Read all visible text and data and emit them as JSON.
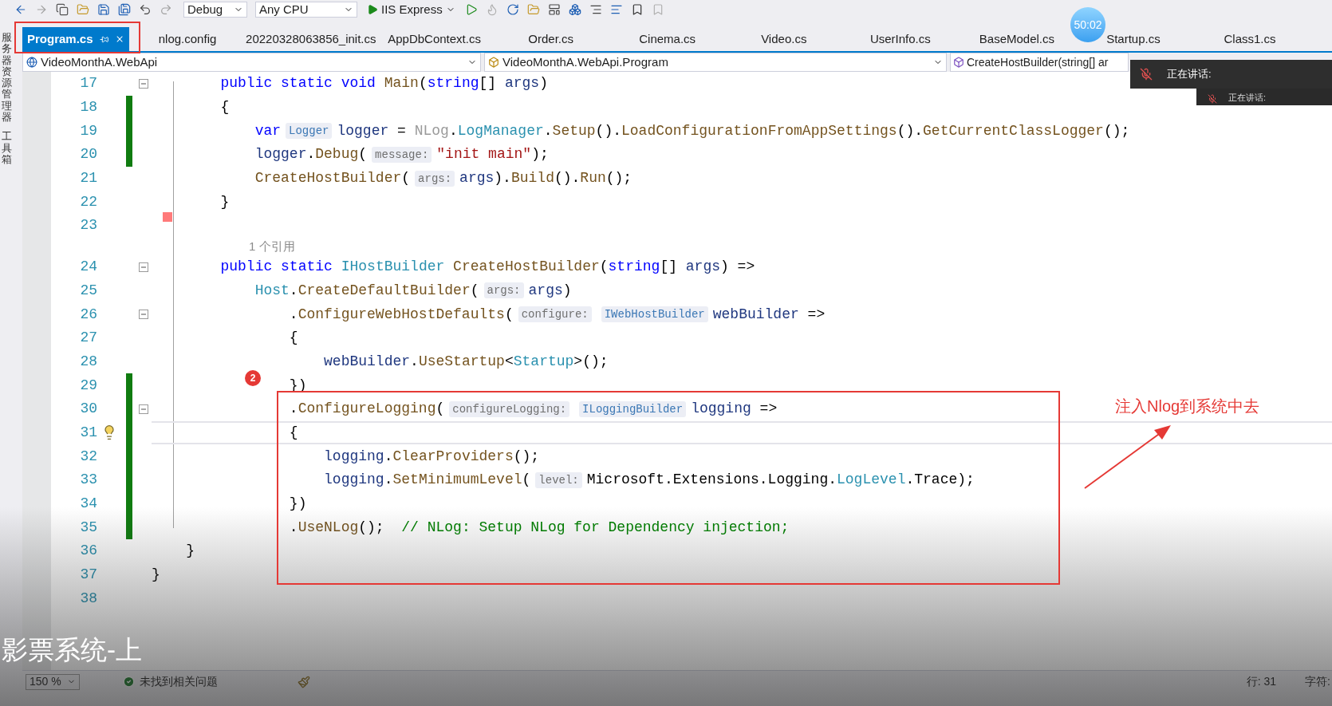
{
  "toolbar": {
    "configuration": "Debug",
    "platform": "Any CPU",
    "run_target": "IIS Express"
  },
  "timer": "50:02",
  "side_panels": [
    "服务器资源管理器",
    "工具箱"
  ],
  "tabs": [
    {
      "label": "Program.cs",
      "selected": true
    },
    {
      "label": "nlog.config",
      "selected": false
    },
    {
      "label": "20220328063856_init.cs",
      "selected": false
    },
    {
      "label": "AppDbContext.cs",
      "selected": false
    },
    {
      "label": "Order.cs",
      "selected": false
    },
    {
      "label": "Cinema.cs",
      "selected": false
    },
    {
      "label": "Video.cs",
      "selected": false
    },
    {
      "label": "UserInfo.cs",
      "selected": false
    },
    {
      "label": "BaseModel.cs",
      "selected": false
    },
    {
      "label": "Startup.cs",
      "selected": false
    },
    {
      "label": "Class1.cs",
      "selected": false
    }
  ],
  "nav": {
    "project": "VideoMonthA.WebApi",
    "type": "VideoMonthA.WebApi.Program",
    "member": "CreateHostBuilder(string[] ar"
  },
  "speaker_panels": [
    {
      "label": "正在讲话:"
    },
    {
      "label": "正在讲话:"
    }
  ],
  "code_lines": [
    {
      "kind": "code",
      "number": "17",
      "changed": false,
      "foldable": true,
      "current": false,
      "lightbulb": false,
      "tokens": [
        {
          "kind": "kw",
          "text": "        public static void"
        },
        {
          "kind": "fn",
          "text": " Main"
        },
        {
          "kind": "p",
          "text": "("
        },
        {
          "kind": "kw",
          "text": "string"
        },
        {
          "kind": "p",
          "text": "[] "
        },
        {
          "kind": "var",
          "text": "args"
        },
        {
          "kind": "p",
          "text": ")"
        }
      ]
    },
    {
      "kind": "code",
      "number": "18",
      "changed": true,
      "foldable": false,
      "current": false,
      "lightbulb": false,
      "tokens": [
        {
          "kind": "p",
          "text": "        {"
        }
      ]
    },
    {
      "kind": "code",
      "number": "19",
      "changed": true,
      "foldable": false,
      "current": false,
      "lightbulb": false,
      "tokens": [
        {
          "kind": "kw",
          "text": "            var"
        },
        {
          "kind": "typehint",
          "text": "Logger"
        },
        {
          "kind": "var",
          "text": "logger"
        },
        {
          "kind": "p",
          "text": " = "
        },
        {
          "kind": "dim",
          "text": "NLog"
        },
        {
          "kind": "p",
          "text": "."
        },
        {
          "kind": "type",
          "text": "LogManager"
        },
        {
          "kind": "p",
          "text": "."
        },
        {
          "kind": "fn",
          "text": "Setup"
        },
        {
          "kind": "p",
          "text": "()."
        },
        {
          "kind": "fn",
          "text": "LoadConfigurationFromAppSettings"
        },
        {
          "kind": "p",
          "text": "()."
        },
        {
          "kind": "fn",
          "text": "GetCurrentClassLogger"
        },
        {
          "kind": "p",
          "text": "();"
        }
      ]
    },
    {
      "kind": "code",
      "number": "20",
      "changed": true,
      "foldable": false,
      "current": false,
      "lightbulb": false,
      "tokens": [
        {
          "kind": "var",
          "text": "            logger"
        },
        {
          "kind": "p",
          "text": "."
        },
        {
          "kind": "fn",
          "text": "Debug"
        },
        {
          "kind": "p",
          "text": "("
        },
        {
          "kind": "hint",
          "text": "message:"
        },
        {
          "kind": "str",
          "text": "\"init main\""
        },
        {
          "kind": "p",
          "text": ");"
        }
      ]
    },
    {
      "kind": "code",
      "number": "21",
      "changed": false,
      "foldable": false,
      "current": false,
      "lightbulb": false,
      "tokens": [
        {
          "kind": "fn",
          "text": "            CreateHostBuilder"
        },
        {
          "kind": "p",
          "text": "("
        },
        {
          "kind": "hint",
          "text": "args:"
        },
        {
          "kind": "var",
          "text": "args"
        },
        {
          "kind": "p",
          "text": ")."
        },
        {
          "kind": "fn",
          "text": "Build"
        },
        {
          "kind": "p",
          "text": "()."
        },
        {
          "kind": "fn",
          "text": "Run"
        },
        {
          "kind": "p",
          "text": "();"
        }
      ]
    },
    {
      "kind": "code",
      "number": "22",
      "changed": false,
      "foldable": false,
      "current": false,
      "lightbulb": false,
      "tokens": [
        {
          "kind": "p",
          "text": "        }"
        }
      ]
    },
    {
      "kind": "code",
      "number": "23",
      "changed": false,
      "foldable": false,
      "current": false,
      "lightbulb": false
    },
    {
      "kind": "lens",
      "text": "1 个引用"
    },
    {
      "kind": "code",
      "number": "24",
      "changed": false,
      "foldable": true,
      "current": false,
      "lightbulb": false,
      "tokens": [
        {
          "kind": "kw",
          "text": "        public static"
        },
        {
          "kind": "type",
          "text": " IHostBuilder"
        },
        {
          "kind": "fn",
          "text": " CreateHostBuilder"
        },
        {
          "kind": "p",
          "text": "("
        },
        {
          "kind": "kw",
          "text": "string"
        },
        {
          "kind": "p",
          "text": "[] "
        },
        {
          "kind": "var",
          "text": "args"
        },
        {
          "kind": "p",
          "text": ") =>"
        }
      ]
    },
    {
      "kind": "code",
      "number": "25",
      "changed": false,
      "foldable": false,
      "current": false,
      "lightbulb": false,
      "tokens": [
        {
          "kind": "type",
          "text": "            Host"
        },
        {
          "kind": "p",
          "text": "."
        },
        {
          "kind": "fn",
          "text": "CreateDefaultBuilder"
        },
        {
          "kind": "p",
          "text": "("
        },
        {
          "kind": "hint",
          "text": "args:"
        },
        {
          "kind": "var",
          "text": "args"
        },
        {
          "kind": "p",
          "text": ")"
        }
      ]
    },
    {
      "kind": "code",
      "number": "26",
      "changed": false,
      "foldable": true,
      "current": false,
      "lightbulb": false,
      "tokens": [
        {
          "kind": "p",
          "text": "                ."
        },
        {
          "kind": "fn",
          "text": "ConfigureWebHostDefaults"
        },
        {
          "kind": "p",
          "text": "("
        },
        {
          "kind": "hint",
          "text": "configure:"
        },
        {
          "kind": "typehint",
          "text": "IWebHostBuilder"
        },
        {
          "kind": "var",
          "text": "webBuilder"
        },
        {
          "kind": "p",
          "text": " =>"
        }
      ]
    },
    {
      "kind": "code",
      "number": "27",
      "changed": false,
      "foldable": false,
      "current": false,
      "lightbulb": false,
      "tokens": [
        {
          "kind": "p",
          "text": "                {"
        }
      ]
    },
    {
      "kind": "code",
      "number": "28",
      "changed": false,
      "foldable": false,
      "current": false,
      "lightbulb": false,
      "tokens": [
        {
          "kind": "var",
          "text": "                    webBuilder"
        },
        {
          "kind": "p",
          "text": "."
        },
        {
          "kind": "fn",
          "text": "UseStartup"
        },
        {
          "kind": "p",
          "text": "<"
        },
        {
          "kind": "type",
          "text": "Startup"
        },
        {
          "kind": "p",
          "text": ">();"
        }
      ]
    },
    {
      "kind": "code",
      "number": "29",
      "changed": true,
      "foldable": false,
      "current": false,
      "lightbulb": false,
      "tokens": [
        {
          "kind": "p",
          "text": "                })"
        }
      ]
    },
    {
      "kind": "code",
      "number": "30",
      "changed": true,
      "foldable": true,
      "current": false,
      "lightbulb": false,
      "tokens": [
        {
          "kind": "p",
          "text": "                ."
        },
        {
          "kind": "fn",
          "text": "ConfigureLogging"
        },
        {
          "kind": "p",
          "text": "("
        },
        {
          "kind": "hint",
          "text": "configureLogging:"
        },
        {
          "kind": "typehint",
          "text": "ILoggingBuilder"
        },
        {
          "kind": "var",
          "text": "logging"
        },
        {
          "kind": "p",
          "text": " =>"
        }
      ]
    },
    {
      "kind": "code",
      "number": "31",
      "changed": true,
      "foldable": false,
      "current": true,
      "lightbulb": true,
      "tokens": [
        {
          "kind": "p",
          "text": "                {"
        }
      ]
    },
    {
      "kind": "code",
      "number": "32",
      "changed": true,
      "foldable": false,
      "current": false,
      "lightbulb": false,
      "tokens": [
        {
          "kind": "var",
          "text": "                    logging"
        },
        {
          "kind": "p",
          "text": "."
        },
        {
          "kind": "fn",
          "text": "ClearProviders"
        },
        {
          "kind": "p",
          "text": "();"
        }
      ]
    },
    {
      "kind": "code",
      "number": "33",
      "changed": true,
      "foldable": false,
      "current": false,
      "lightbulb": false,
      "tokens": [
        {
          "kind": "var",
          "text": "                    logging"
        },
        {
          "kind": "p",
          "text": "."
        },
        {
          "kind": "fn",
          "text": "SetMinimumLevel"
        },
        {
          "kind": "p",
          "text": "("
        },
        {
          "kind": "hint",
          "text": "level:"
        },
        {
          "kind": "p",
          "text": "Microsoft.Extensions.Logging."
        },
        {
          "kind": "type",
          "text": "LogLevel"
        },
        {
          "kind": "p",
          "text": ".Trace);"
        }
      ]
    },
    {
      "kind": "code",
      "number": "34",
      "changed": true,
      "foldable": false,
      "current": false,
      "lightbulb": false,
      "tokens": [
        {
          "kind": "p",
          "text": "                })"
        }
      ]
    },
    {
      "kind": "code",
      "number": "35",
      "changed": true,
      "foldable": false,
      "current": false,
      "lightbulb": false,
      "tokens": [
        {
          "kind": "p",
          "text": "                ."
        },
        {
          "kind": "fn",
          "text": "UseNLog"
        },
        {
          "kind": "p",
          "text": "();"
        },
        {
          "kind": "cmt",
          "text": "  // NLog: Setup NLog for Dependency injection;"
        }
      ]
    },
    {
      "kind": "code",
      "number": "36",
      "changed": false,
      "foldable": false,
      "current": false,
      "lightbulb": false,
      "tokens": [
        {
          "kind": "p",
          "text": "    }"
        }
      ]
    },
    {
      "kind": "code",
      "number": "37",
      "changed": false,
      "foldable": false,
      "current": false,
      "lightbulb": false,
      "tokens": [
        {
          "kind": "p",
          "text": "}"
        }
      ]
    },
    {
      "kind": "code",
      "number": "38",
      "changed": false,
      "foldable": false,
      "current": false,
      "lightbulb": false
    }
  ],
  "annotation": {
    "badge": "2",
    "note": "注入Nlog到系统中去"
  },
  "subtitle": "影票系统-上",
  "status_bar": {
    "zoom": "150 %",
    "issues": "未找到相关问题",
    "line": "行: 31",
    "column": "字符:"
  }
}
